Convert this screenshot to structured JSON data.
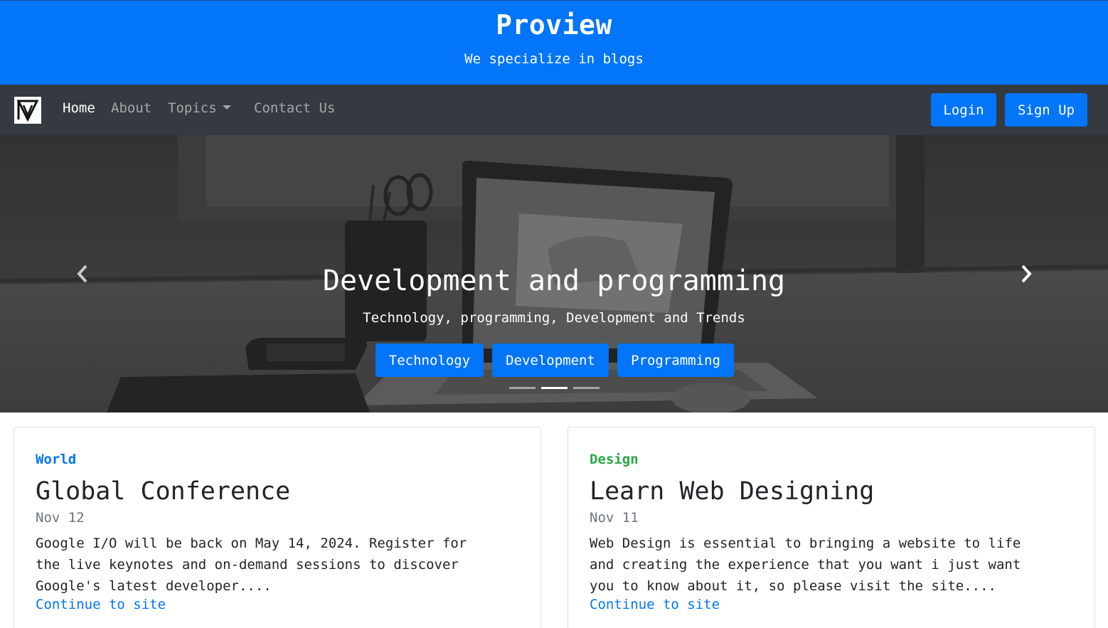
{
  "header": {
    "title": "Proview",
    "tagline": "We specialize in blogs"
  },
  "nav": {
    "links": [
      "Home",
      "About",
      "Topics",
      "Contact Us"
    ],
    "login_label": "Login",
    "signup_label": "Sign Up"
  },
  "carousel": {
    "title": "Development and programming",
    "subtitle": "Technology, programming, Development and Trends",
    "buttons": [
      "Technology",
      "Development",
      "Programming"
    ],
    "active_slide": 2,
    "slide_count": 3
  },
  "posts": [
    {
      "category": "World",
      "category_color": "#0275f8",
      "title": "Global Conference",
      "date": "Nov 12",
      "lines": [
        "Google I/O will be back on May 14, 2024. Register for",
        "the live keynotes and on-demand sessions to discover",
        "Google's latest developer...."
      ],
      "link": "Continue to site"
    },
    {
      "category": "Design",
      "category_color": "#28a745",
      "title": "Learn Web Designing",
      "date": "Nov 11",
      "lines": [
        "Web Design is essential to bringing a website to life",
        "and creating the experience that you want i just want",
        "you to know about it, so please visit the site...."
      ],
      "link": "Continue to site"
    }
  ],
  "colors": {
    "primary": "#0275f8",
    "navbar": "#343a40",
    "design_green": "#28a745"
  }
}
